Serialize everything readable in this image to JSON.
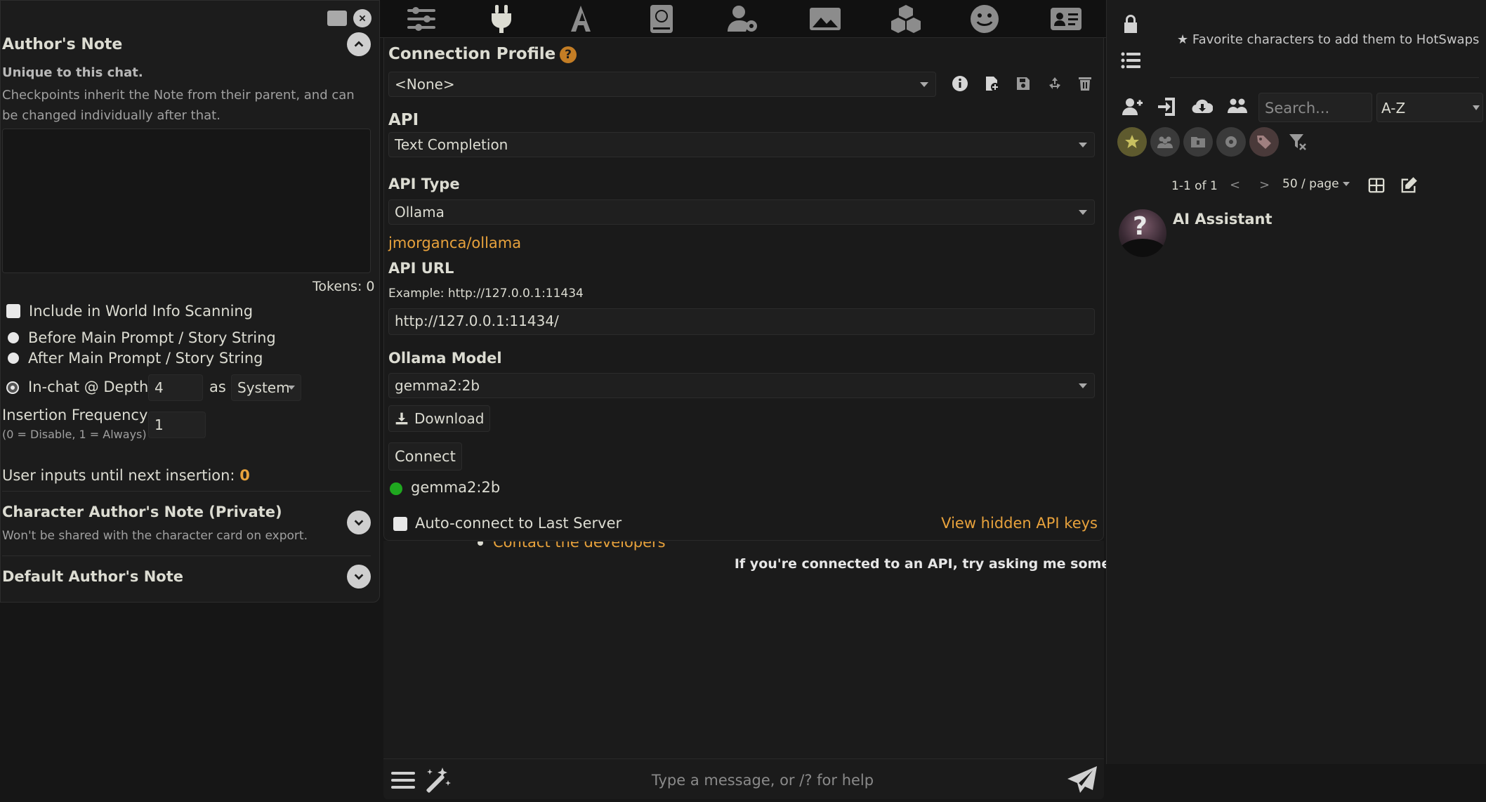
{
  "left": {
    "title": "Author's Note",
    "unique_note": "Unique to this chat.",
    "description": "Checkpoints inherit the Note from their parent, and can be changed individually after that.",
    "tokens": "Tokens: 0",
    "include_wi": "Include in World Info Scanning",
    "before_main": "Before Main Prompt / Story String",
    "after_main": "After Main Prompt / Story String",
    "in_chat_depth": "In-chat @ Depth",
    "depth_value": "4",
    "as_label": "as",
    "role_value": "System",
    "insertion_freq": "Insertion Frequency",
    "insertion_hint": "(0 = Disable, 1 = Always)",
    "freq_value": "1",
    "user_inputs_label": "User inputs until next insertion:",
    "user_inputs_value": "0",
    "char_note_title": "Character Author's Note (Private)",
    "char_note_desc": "Won't be shared with the character card on export.",
    "default_note_title": "Default Author's Note"
  },
  "middle": {
    "connection_profile": "Connection Profile",
    "help": "?",
    "profile_value": "<None>",
    "api_label": "API",
    "api_value": "Text Completion",
    "api_type_label": "API Type",
    "api_type_value": "Ollama",
    "ollama_link": "jmorganca/ollama",
    "api_url_label": "API URL",
    "api_url_example": "Example: http://127.0.0.1:11434",
    "api_url_value": "http://127.0.0.1:11434/",
    "model_label": "Ollama Model",
    "model_value": "gemma2:2b",
    "download_label": "Download",
    "connect_label": "Connect",
    "status_model": "gemma2:2b",
    "status_color": "#1fa81f",
    "auto_connect": "Auto-connect to Last Server",
    "view_keys": "View hidden API keys",
    "contact_dev": "Contact the developers",
    "try_asking": "If you're connected to an API, try asking me something!",
    "message_placeholder": "Type a message, or /? for help"
  },
  "right": {
    "favorites_hint": "Favorite characters to add them to HotSwaps",
    "search_placeholder": "Search...",
    "sort_value": "A-Z",
    "pagination": "1-1 of 1",
    "prev": "<",
    "next": ">",
    "per_page": "50 / page",
    "character_name": "AI Assistant"
  },
  "colors": {
    "accent": "#e8a23c",
    "status_ok": "#1fa81f"
  }
}
